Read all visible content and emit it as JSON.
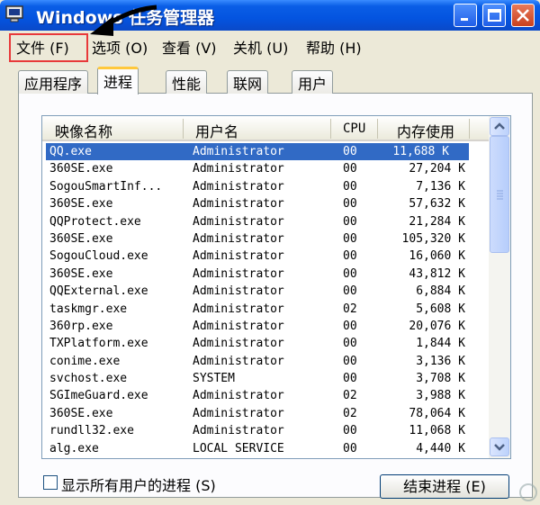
{
  "window": {
    "title": "Windows 任务管理器"
  },
  "menu": [
    {
      "label": "文件",
      "accel": "(F)"
    },
    {
      "label": "选项",
      "accel": "(O)"
    },
    {
      "label": "查看",
      "accel": "(V)"
    },
    {
      "label": "关机",
      "accel": "(U)"
    },
    {
      "label": "帮助",
      "accel": "(H)"
    }
  ],
  "tabs": [
    "应用程序",
    "进程",
    "性能",
    "联网",
    "用户"
  ],
  "active_tab": "进程",
  "columns": {
    "name": "映像名称",
    "user": "用户名",
    "cpu": "CPU",
    "mem": "内存使用"
  },
  "processes": [
    {
      "name": "QQ.exe",
      "user": "Administrator",
      "cpu": "00",
      "mem": "11,688 K",
      "selected": true
    },
    {
      "name": "360SE.exe",
      "user": "Administrator",
      "cpu": "00",
      "mem": "27,204 K"
    },
    {
      "name": "SogouSmartInf...",
      "user": "Administrator",
      "cpu": "00",
      "mem": "7,136 K"
    },
    {
      "name": "360SE.exe",
      "user": "Administrator",
      "cpu": "00",
      "mem": "57,632 K"
    },
    {
      "name": "QQProtect.exe",
      "user": "Administrator",
      "cpu": "00",
      "mem": "21,284 K"
    },
    {
      "name": "360SE.exe",
      "user": "Administrator",
      "cpu": "00",
      "mem": "105,320 K"
    },
    {
      "name": "SogouCloud.exe",
      "user": "Administrator",
      "cpu": "00",
      "mem": "16,060 K"
    },
    {
      "name": "360SE.exe",
      "user": "Administrator",
      "cpu": "00",
      "mem": "43,812 K"
    },
    {
      "name": "QQExternal.exe",
      "user": "Administrator",
      "cpu": "00",
      "mem": "6,884 K"
    },
    {
      "name": "taskmgr.exe",
      "user": "Administrator",
      "cpu": "02",
      "mem": "5,608 K"
    },
    {
      "name": "360rp.exe",
      "user": "Administrator",
      "cpu": "00",
      "mem": "20,076 K"
    },
    {
      "name": "TXPlatform.exe",
      "user": "Administrator",
      "cpu": "00",
      "mem": "1,844 K"
    },
    {
      "name": "conime.exe",
      "user": "Administrator",
      "cpu": "00",
      "mem": "3,136 K"
    },
    {
      "name": "svchost.exe",
      "user": "SYSTEM",
      "cpu": "00",
      "mem": "3,708 K"
    },
    {
      "name": "SGImeGuard.exe",
      "user": "Administrator",
      "cpu": "02",
      "mem": "3,988 K"
    },
    {
      "name": "360SE.exe",
      "user": "Administrator",
      "cpu": "02",
      "mem": "78,064 K"
    },
    {
      "name": "rundll32.exe",
      "user": "Administrator",
      "cpu": "00",
      "mem": "11,068 K"
    },
    {
      "name": "alg.exe",
      "user": "LOCAL SERVICE",
      "cpu": "00",
      "mem": "4,440 K"
    }
  ],
  "show_all_users": {
    "label": "显示所有用户的进程",
    "accel": "(S)",
    "checked": false
  },
  "end_process_button": {
    "label": "结束进程",
    "accel": "(E)"
  },
  "colors": {
    "titlebar": "#0454e0",
    "selection": "#316ac5",
    "highlight_box": "#e8393a"
  }
}
